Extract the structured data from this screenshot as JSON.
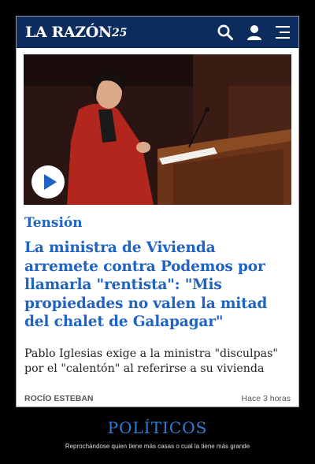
{
  "header": {
    "logo_text": "LA RAZÓN",
    "logo_badge": "25",
    "icons": [
      "search-icon",
      "user-icon",
      "menu-icon"
    ],
    "bg_color": "#0d2c5e"
  },
  "article": {
    "kicker": "Tensión",
    "headline": "La ministra de Vivienda arremete contra Podemos por llamarla \"rentista\": \"Mis propiedades no valen la mitad del chalet de Galapagar\"",
    "subhead": "Pablo Iglesias exige a la ministra \"disculpas\" por el \"calentón\" al referirse a su vivienda",
    "author": "ROCÍO ESTEBAN",
    "time": "Hace 3 horas",
    "accent_color": "#1f63c5"
  },
  "meme": {
    "title": "POLÍTICOS",
    "caption": "Reprochándose quien tiene más casas o cual la tiene más grande"
  }
}
